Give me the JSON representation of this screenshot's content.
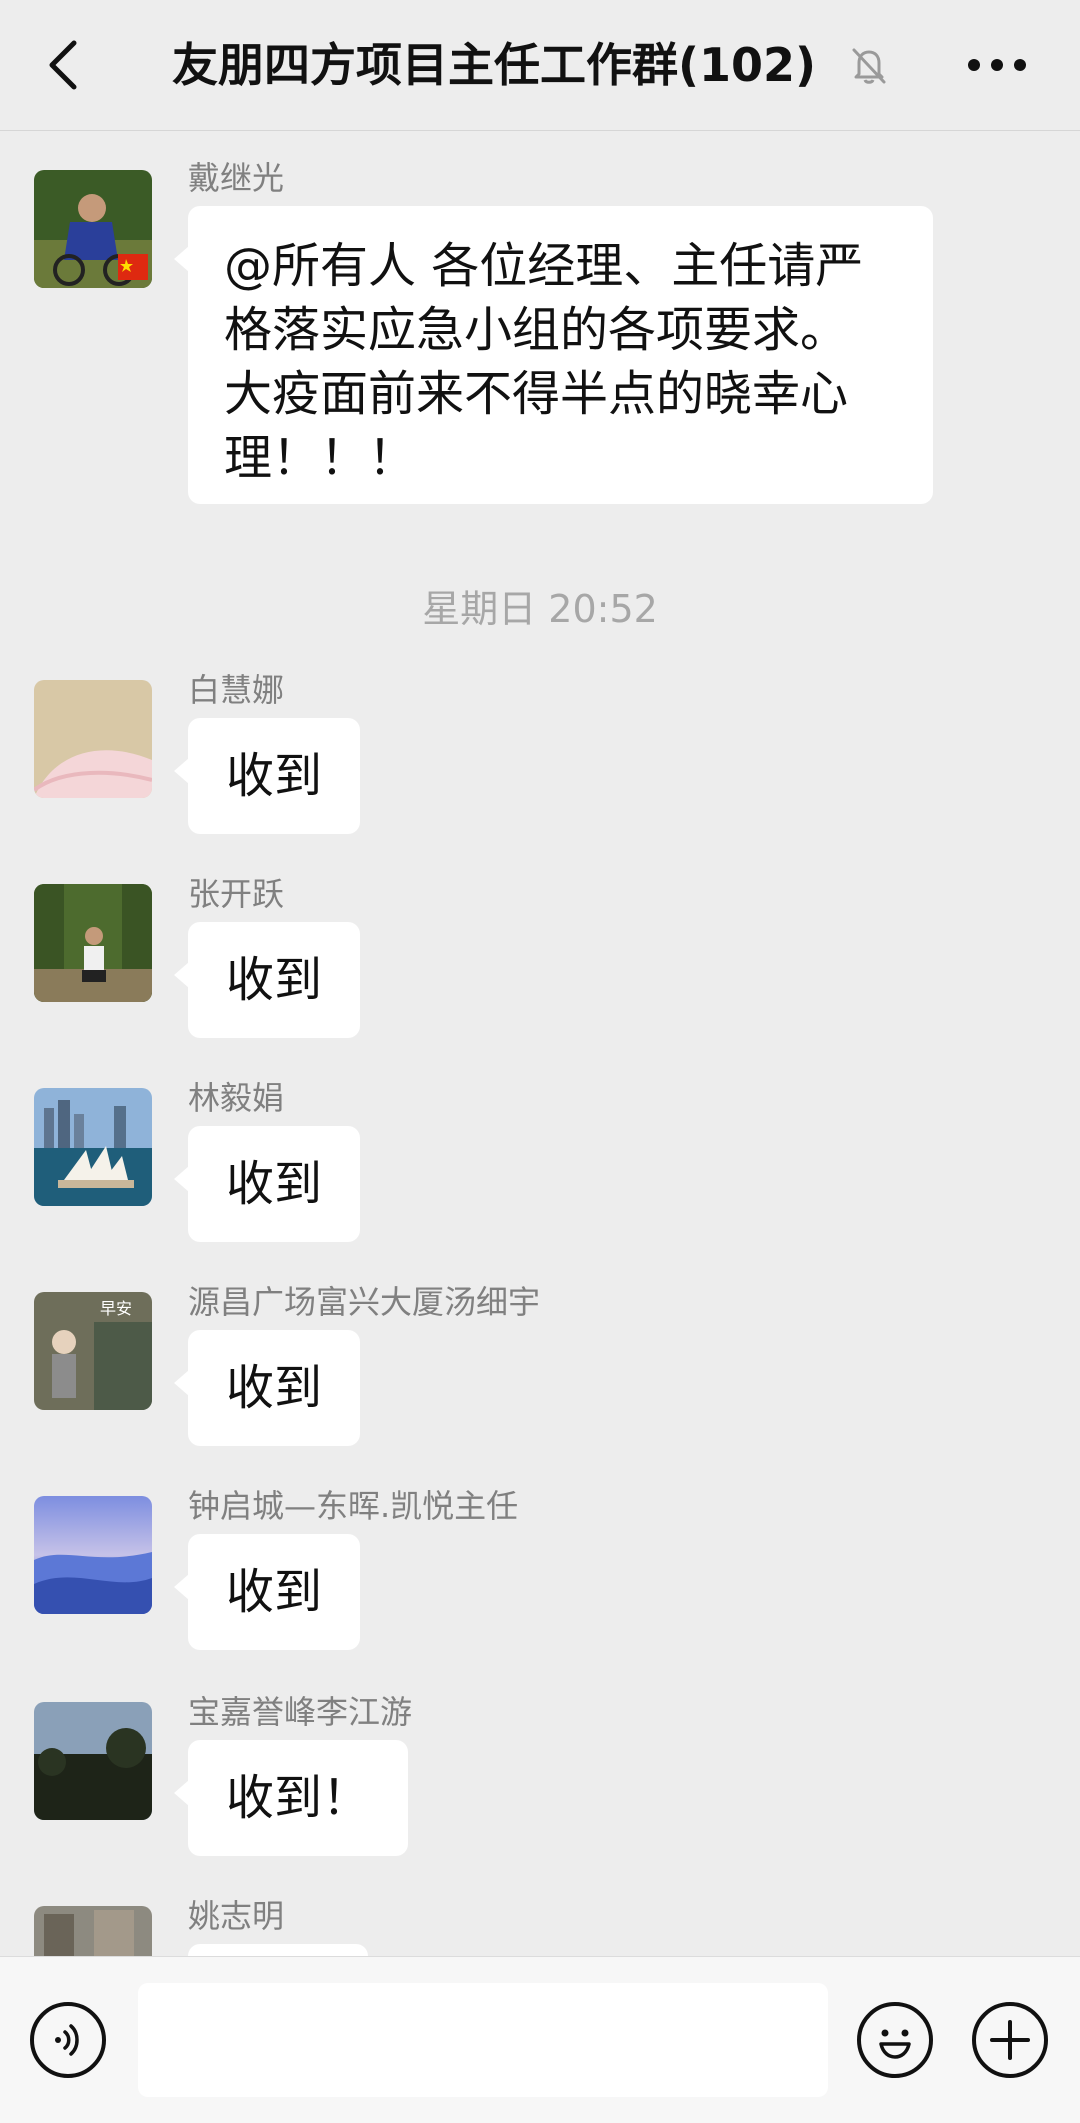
{
  "header": {
    "title": "友朋四方项目主任工作群(102)",
    "back_icon": "chevron-left-icon",
    "mute_icon": "bell-off-icon",
    "more_icon": "more-horizontal-icon"
  },
  "messages": [
    {
      "sender": "戴继光",
      "lines": [
        "@所有人  各位经理、主任请严",
        "格落实应急小组的各项要求。",
        "大疫面前来不得半点的晓幸心",
        "理！！！"
      ]
    },
    {
      "sender": "白慧娜",
      "text": "收到"
    },
    {
      "sender": "张开跃",
      "text": "收到"
    },
    {
      "sender": "林毅娟",
      "text": "收到"
    },
    {
      "sender": "源昌广场富兴大厦汤细宇",
      "text": "收到",
      "avatar_caption": "早安"
    },
    {
      "sender": "钟启城—东晖.凯悦主任",
      "text": "收到"
    },
    {
      "sender": "宝嘉誉峰李江游",
      "text": "收到！"
    },
    {
      "sender": "姚志明",
      "text": ""
    }
  ],
  "timestamp": "星期日 20:52",
  "input_bar": {
    "voice_icon": "voice-icon",
    "emoji_icon": "emoji-icon",
    "plus_icon": "plus-icon",
    "input_value": ""
  }
}
